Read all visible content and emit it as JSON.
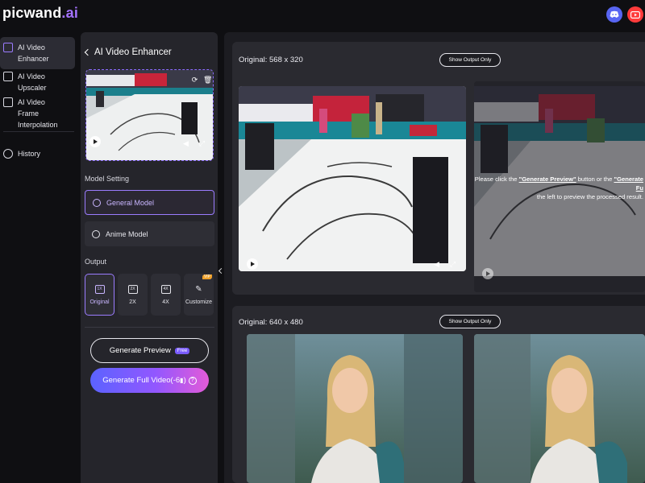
{
  "app": {
    "logo_main": "picwand",
    "logo_ext": ".ai",
    "icons": [
      "discord-icon",
      "youtube-icon"
    ]
  },
  "nav": {
    "items": [
      {
        "label": "AI Video Enhancer",
        "icon": "video-enhance-icon",
        "active": true
      },
      {
        "label": "AI Video Upscaler",
        "icon": "video-upscale-icon",
        "active": false
      },
      {
        "label": "AI Video Frame Interpolation",
        "icon": "frame-interpolation-icon",
        "active": false
      },
      {
        "label": "History",
        "icon": "history-icon",
        "active": false
      }
    ]
  },
  "panel": {
    "title": "AI Video Enhancer",
    "model_setting_label": "Model Setting",
    "models": [
      {
        "label": "General Model",
        "selected": true
      },
      {
        "label": "Anime Model",
        "selected": false
      }
    ],
    "output_label": "Output",
    "output_options": [
      {
        "icon_text": "1X",
        "label": "Original",
        "selected": true
      },
      {
        "icon_text": "2X",
        "label": "2X",
        "selected": false
      },
      {
        "icon_text": "4X",
        "label": "4X",
        "selected": false
      },
      {
        "icon_text": "",
        "label": "Customize",
        "selected": false,
        "badge": "VIP"
      }
    ],
    "generate_preview_label": "Generate Preview",
    "free_badge": "Free",
    "generate_full_label": "Generate Full Video(-6",
    "generate_full_suffix": ")",
    "help_icon": "?"
  },
  "main": {
    "cards": [
      {
        "title": "Original: 568 x 320",
        "show_output_label": "Show Output Only",
        "overlay_line1_pre": "Please click the ",
        "overlay_link1": "\"Generate Preview\"",
        "overlay_line1_mid": " button or the ",
        "overlay_link2": "\"Generate Fu",
        "overlay_line2": "the left to preview the processed result."
      },
      {
        "title": "Original: 640 x 480",
        "show_output_label": "Show Output Only"
      }
    ]
  },
  "colors": {
    "accent": "#9b7cff",
    "background": "#0f0f12",
    "panel": "#25252b",
    "discord": "#5865f2",
    "youtube": "#ff3b3b"
  }
}
